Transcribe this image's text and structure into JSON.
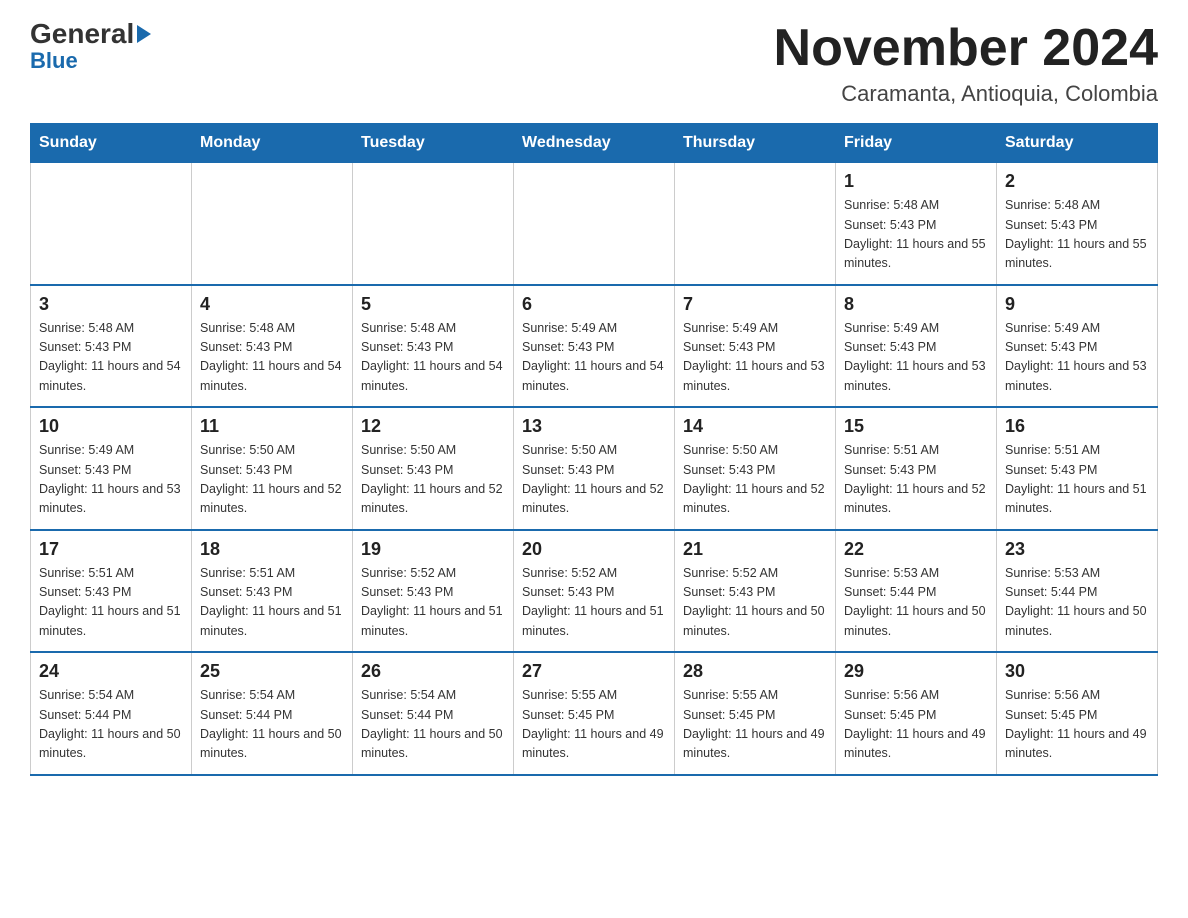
{
  "logo": {
    "general": "General",
    "arrow": "▶",
    "blue": "Blue"
  },
  "title": "November 2024",
  "subtitle": "Caramanta, Antioquia, Colombia",
  "days_of_week": [
    "Sunday",
    "Monday",
    "Tuesday",
    "Wednesday",
    "Thursday",
    "Friday",
    "Saturday"
  ],
  "weeks": [
    [
      {
        "day": "",
        "sunrise": "",
        "sunset": "",
        "daylight": ""
      },
      {
        "day": "",
        "sunrise": "",
        "sunset": "",
        "daylight": ""
      },
      {
        "day": "",
        "sunrise": "",
        "sunset": "",
        "daylight": ""
      },
      {
        "day": "",
        "sunrise": "",
        "sunset": "",
        "daylight": ""
      },
      {
        "day": "",
        "sunrise": "",
        "sunset": "",
        "daylight": ""
      },
      {
        "day": "1",
        "sunrise": "Sunrise: 5:48 AM",
        "sunset": "Sunset: 5:43 PM",
        "daylight": "Daylight: 11 hours and 55 minutes."
      },
      {
        "day": "2",
        "sunrise": "Sunrise: 5:48 AM",
        "sunset": "Sunset: 5:43 PM",
        "daylight": "Daylight: 11 hours and 55 minutes."
      }
    ],
    [
      {
        "day": "3",
        "sunrise": "Sunrise: 5:48 AM",
        "sunset": "Sunset: 5:43 PM",
        "daylight": "Daylight: 11 hours and 54 minutes."
      },
      {
        "day": "4",
        "sunrise": "Sunrise: 5:48 AM",
        "sunset": "Sunset: 5:43 PM",
        "daylight": "Daylight: 11 hours and 54 minutes."
      },
      {
        "day": "5",
        "sunrise": "Sunrise: 5:48 AM",
        "sunset": "Sunset: 5:43 PM",
        "daylight": "Daylight: 11 hours and 54 minutes."
      },
      {
        "day": "6",
        "sunrise": "Sunrise: 5:49 AM",
        "sunset": "Sunset: 5:43 PM",
        "daylight": "Daylight: 11 hours and 54 minutes."
      },
      {
        "day": "7",
        "sunrise": "Sunrise: 5:49 AM",
        "sunset": "Sunset: 5:43 PM",
        "daylight": "Daylight: 11 hours and 53 minutes."
      },
      {
        "day": "8",
        "sunrise": "Sunrise: 5:49 AM",
        "sunset": "Sunset: 5:43 PM",
        "daylight": "Daylight: 11 hours and 53 minutes."
      },
      {
        "day": "9",
        "sunrise": "Sunrise: 5:49 AM",
        "sunset": "Sunset: 5:43 PM",
        "daylight": "Daylight: 11 hours and 53 minutes."
      }
    ],
    [
      {
        "day": "10",
        "sunrise": "Sunrise: 5:49 AM",
        "sunset": "Sunset: 5:43 PM",
        "daylight": "Daylight: 11 hours and 53 minutes."
      },
      {
        "day": "11",
        "sunrise": "Sunrise: 5:50 AM",
        "sunset": "Sunset: 5:43 PM",
        "daylight": "Daylight: 11 hours and 52 minutes."
      },
      {
        "day": "12",
        "sunrise": "Sunrise: 5:50 AM",
        "sunset": "Sunset: 5:43 PM",
        "daylight": "Daylight: 11 hours and 52 minutes."
      },
      {
        "day": "13",
        "sunrise": "Sunrise: 5:50 AM",
        "sunset": "Sunset: 5:43 PM",
        "daylight": "Daylight: 11 hours and 52 minutes."
      },
      {
        "day": "14",
        "sunrise": "Sunrise: 5:50 AM",
        "sunset": "Sunset: 5:43 PM",
        "daylight": "Daylight: 11 hours and 52 minutes."
      },
      {
        "day": "15",
        "sunrise": "Sunrise: 5:51 AM",
        "sunset": "Sunset: 5:43 PM",
        "daylight": "Daylight: 11 hours and 52 minutes."
      },
      {
        "day": "16",
        "sunrise": "Sunrise: 5:51 AM",
        "sunset": "Sunset: 5:43 PM",
        "daylight": "Daylight: 11 hours and 51 minutes."
      }
    ],
    [
      {
        "day": "17",
        "sunrise": "Sunrise: 5:51 AM",
        "sunset": "Sunset: 5:43 PM",
        "daylight": "Daylight: 11 hours and 51 minutes."
      },
      {
        "day": "18",
        "sunrise": "Sunrise: 5:51 AM",
        "sunset": "Sunset: 5:43 PM",
        "daylight": "Daylight: 11 hours and 51 minutes."
      },
      {
        "day": "19",
        "sunrise": "Sunrise: 5:52 AM",
        "sunset": "Sunset: 5:43 PM",
        "daylight": "Daylight: 11 hours and 51 minutes."
      },
      {
        "day": "20",
        "sunrise": "Sunrise: 5:52 AM",
        "sunset": "Sunset: 5:43 PM",
        "daylight": "Daylight: 11 hours and 51 minutes."
      },
      {
        "day": "21",
        "sunrise": "Sunrise: 5:52 AM",
        "sunset": "Sunset: 5:43 PM",
        "daylight": "Daylight: 11 hours and 50 minutes."
      },
      {
        "day": "22",
        "sunrise": "Sunrise: 5:53 AM",
        "sunset": "Sunset: 5:44 PM",
        "daylight": "Daylight: 11 hours and 50 minutes."
      },
      {
        "day": "23",
        "sunrise": "Sunrise: 5:53 AM",
        "sunset": "Sunset: 5:44 PM",
        "daylight": "Daylight: 11 hours and 50 minutes."
      }
    ],
    [
      {
        "day": "24",
        "sunrise": "Sunrise: 5:54 AM",
        "sunset": "Sunset: 5:44 PM",
        "daylight": "Daylight: 11 hours and 50 minutes."
      },
      {
        "day": "25",
        "sunrise": "Sunrise: 5:54 AM",
        "sunset": "Sunset: 5:44 PM",
        "daylight": "Daylight: 11 hours and 50 minutes."
      },
      {
        "day": "26",
        "sunrise": "Sunrise: 5:54 AM",
        "sunset": "Sunset: 5:44 PM",
        "daylight": "Daylight: 11 hours and 50 minutes."
      },
      {
        "day": "27",
        "sunrise": "Sunrise: 5:55 AM",
        "sunset": "Sunset: 5:45 PM",
        "daylight": "Daylight: 11 hours and 49 minutes."
      },
      {
        "day": "28",
        "sunrise": "Sunrise: 5:55 AM",
        "sunset": "Sunset: 5:45 PM",
        "daylight": "Daylight: 11 hours and 49 minutes."
      },
      {
        "day": "29",
        "sunrise": "Sunrise: 5:56 AM",
        "sunset": "Sunset: 5:45 PM",
        "daylight": "Daylight: 11 hours and 49 minutes."
      },
      {
        "day": "30",
        "sunrise": "Sunrise: 5:56 AM",
        "sunset": "Sunset: 5:45 PM",
        "daylight": "Daylight: 11 hours and 49 minutes."
      }
    ]
  ]
}
